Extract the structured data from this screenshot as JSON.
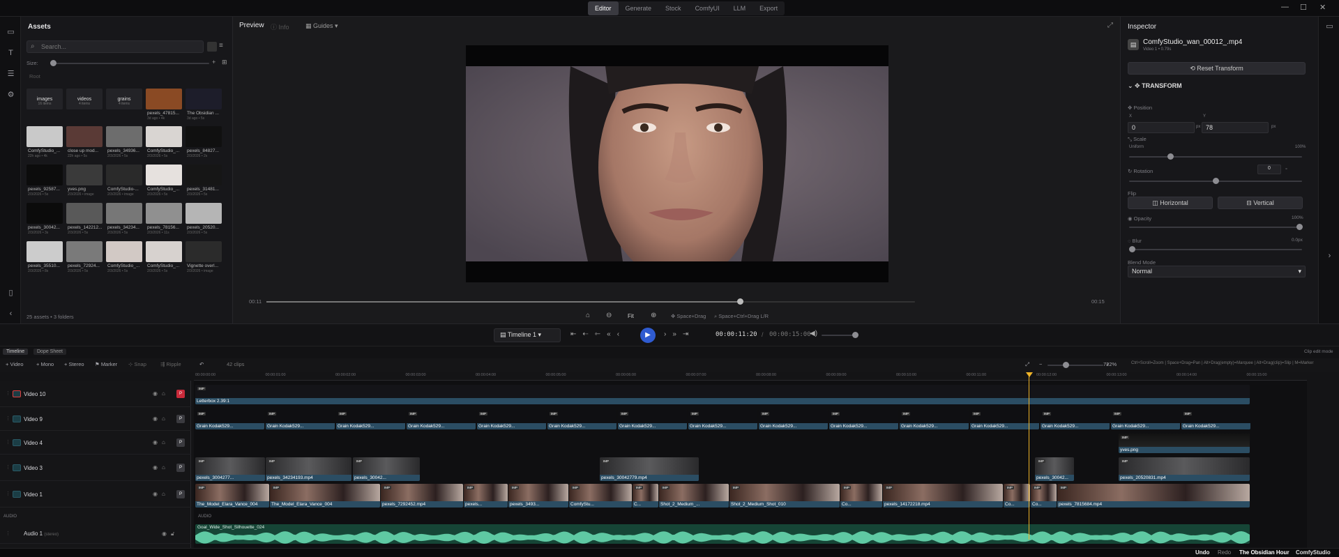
{
  "nav": {
    "tabs": [
      "Editor",
      "Generate",
      "Stock",
      "ComfyUI",
      "LLM",
      "Export"
    ]
  },
  "assets": {
    "title": "Assets",
    "search_placeholder": "Search...",
    "size_label": "Size:",
    "breadcrumb": "Root",
    "folders": [
      {
        "name": "images",
        "count": "16 items"
      },
      {
        "name": "videos",
        "count": "4 items"
      },
      {
        "name": "grains",
        "count": "4 items"
      }
    ],
    "items": [
      {
        "name": "pexels_47815...",
        "meta": "3d ago • 4k"
      },
      {
        "name": "The Obsidian ...",
        "meta": "3d ago • 5s"
      },
      {
        "name": "ComfyStudio_...",
        "meta": "22h ago • 4k"
      },
      {
        "name": "close up mod...",
        "meta": "22h ago • 5s"
      },
      {
        "name": "pexels_34936...",
        "meta": "2/3/2026 • 5s"
      },
      {
        "name": "ComfyStudio_...",
        "meta": "2/3/2026 • 5s"
      },
      {
        "name": "pexels_84827...",
        "meta": "2/3/2026 • 2s"
      },
      {
        "name": "pexels_92587...",
        "meta": "2/3/2026 • 5s"
      },
      {
        "name": "yves.png",
        "meta": "2/3/2026 • image"
      },
      {
        "name": "ComfyStudio-...",
        "meta": "2/3/2026 • image"
      },
      {
        "name": "ComfyStudio_...",
        "meta": "2/3/2026 • 5s"
      },
      {
        "name": "pexels_31481...",
        "meta": "2/3/2026 • 5s"
      },
      {
        "name": "pexels_30042...",
        "meta": "2/3/2026 • 3s"
      },
      {
        "name": "pexels_142212...",
        "meta": "2/3/2026 • 5s"
      },
      {
        "name": "pexels_34234...",
        "meta": "2/3/2026 • 5s"
      },
      {
        "name": "pexels_78156...",
        "meta": "2/3/2026 • 11s"
      },
      {
        "name": "pexels_20520...",
        "meta": "2/3/2026 • 5s"
      },
      {
        "name": "pexels_35510...",
        "meta": "2/3/2026 • 8s"
      },
      {
        "name": "pexels_72924...",
        "meta": "2/3/2026 • 5s"
      },
      {
        "name": "ComfyStudio_...",
        "meta": "2/3/2026 • 5s"
      },
      {
        "name": "ComfyStudio_...",
        "meta": "2/3/2026 • 5s"
      },
      {
        "name": "Vignette overl...",
        "meta": "2/3/2026 • image"
      }
    ],
    "footer": "25 assets • 3 folders"
  },
  "preview": {
    "title": "Preview",
    "info": "Info",
    "guides": "Guides",
    "time_current": "00:11",
    "time_total": "00:15",
    "progress": 0.73,
    "fit": "Fit",
    "hint1": "Space+Drag",
    "hint2": "Space+Ctrl+Drag L/R"
  },
  "inspector": {
    "title": "Inspector",
    "clip_name": "ComfyStudio_wan_00012_.mp4",
    "clip_sub": "Video 1 • 0.79s",
    "reset": "Reset Transform",
    "section": "TRANSFORM",
    "position": "Position",
    "x_label": "X",
    "y_label": "Y",
    "x_val": "0",
    "y_val": "78",
    "px": "px",
    "scale": "Scale",
    "uniform": "Uniform",
    "scale_val": "100%",
    "rotation": "Rotation",
    "rotation_val": "0",
    "deg": "°",
    "flip": "Flip",
    "horizontal": "Horizontal",
    "vertical": "Vertical",
    "opacity": "Opacity",
    "opacity_val": "100%",
    "blur": "Blur",
    "blur_val": "0.0px",
    "blend": "Blend Mode",
    "blend_val": "Normal"
  },
  "transport": {
    "timeline": "Timeline 1",
    "current": "00:00:11:20",
    "separator": "/",
    "total": "00:00:15:00"
  },
  "timeline": {
    "tab1": "Timeline",
    "tab2": "Dope Sheet",
    "clip_edit": "Clip edit mode",
    "add_video": "Video",
    "add_mono": "Mono",
    "add_stereo": "Stereo",
    "marker": "Marker",
    "snap": "Snap",
    "ripple": "Ripple",
    "clips_count": "42 clips",
    "zoom": "722%",
    "shortcuts": "Ctrl+Scroll=Zoom | Space+Drag=Pan | Alt+Drag(empty)=Marquee | Alt+Drag(clip)=Slip | M=Marker",
    "ticks": [
      "00:00:00:00",
      "00:00:01:00",
      "00:00:02:00",
      "00:00:03:00",
      "00:00:04:00",
      "00:00:05:00",
      "00:00:06:00",
      "00:00:07:00",
      "00:00:08:00",
      "00:00:09:00",
      "00:00:10:00",
      "00:00:11:00",
      "00:00:12:00",
      "00:00:13:00",
      "00:00:14:00",
      "00:00:15:00"
    ],
    "tracks": [
      {
        "name": "Video 10"
      },
      {
        "name": "Video 9"
      },
      {
        "name": "Video 4"
      },
      {
        "name": "Video 3"
      },
      {
        "name": "Video 1"
      }
    ],
    "audio_label": "AUDIO",
    "audio_track": "Audio 1",
    "audio_stereo": "(stereo)",
    "audio_clip": "Goal_Wide_Shot_Silhouette_024",
    "letterbox": "Letterbox 2.39:1",
    "grain": "Grain Kodak529...",
    "yves": "yves.png",
    "v3_clips": [
      "pexels_3004277...",
      "pexels_34234193.mp4",
      "pexels_30042...",
      "pexels_30042779.mp4",
      "pexels_20520831.mp4"
    ],
    "v1_clips": [
      "The_Model_Elara_Vance_004",
      "The_Model_Elara_Vance_004",
      "pexels_7292452.mp4",
      "pexels...",
      "pexels_3493...",
      "ComfyStu...",
      "C...",
      "Shot_2_Medium_...",
      "Shot_2_Medium_Shot_010",
      "pexels_14172218.mp4",
      "Co...",
      "pexels_7815684.mp4"
    ]
  },
  "status": {
    "undo": "Undo",
    "redo": "Redo",
    "project": "The Obsidian Hour",
    "app": "ComfyStudio"
  }
}
